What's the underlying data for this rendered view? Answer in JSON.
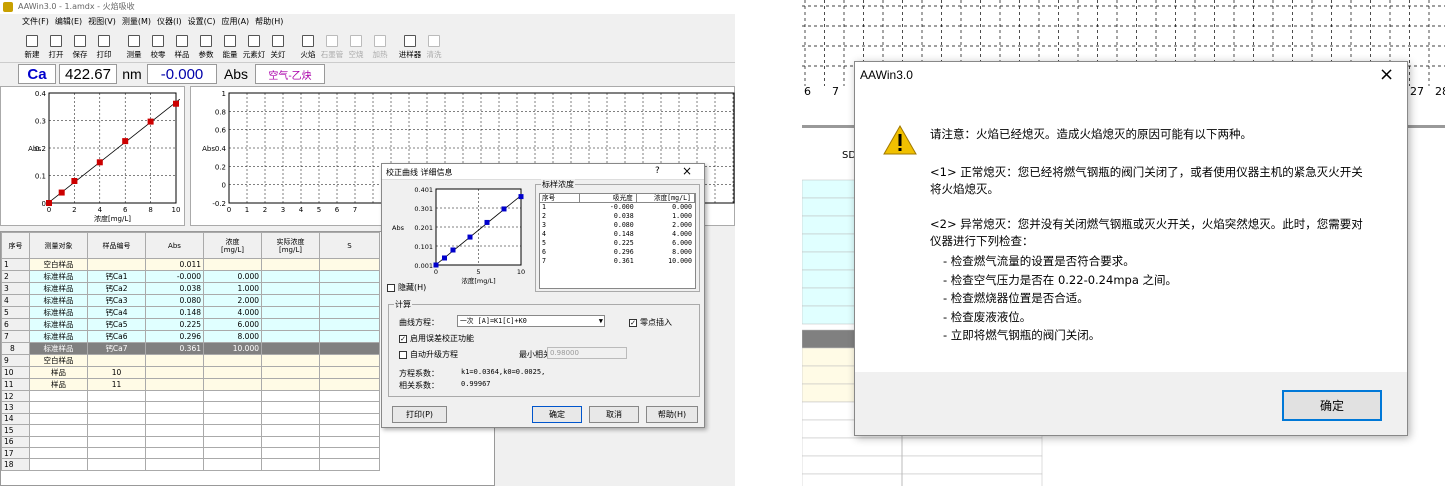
{
  "window": {
    "title": "AAWin3.0 - 1.amdx - 火焰吸收"
  },
  "menu": [
    "文件(F)",
    "编辑(E)",
    "视图(V)",
    "测量(M)",
    "仪器(I)",
    "设置(C)",
    "应用(A)",
    "帮助(H)"
  ],
  "toolbar": [
    {
      "label": "新建",
      "icon": "new-file-icon",
      "enabled": true
    },
    {
      "label": "打开",
      "icon": "open-folder-icon",
      "enabled": true
    },
    {
      "label": "保存",
      "icon": "save-icon",
      "enabled": true
    },
    {
      "label": "打印",
      "icon": "print-icon",
      "enabled": true
    },
    {
      "label": "测量",
      "icon": "play-icon",
      "enabled": true
    },
    {
      "label": "校零",
      "icon": "zero-icon",
      "enabled": true
    },
    {
      "label": "样品",
      "icon": "sample-icon",
      "enabled": true
    },
    {
      "label": "参数",
      "icon": "param-icon",
      "enabled": true
    },
    {
      "label": "能量",
      "icon": "energy-icon",
      "enabled": true
    },
    {
      "label": "元素灯",
      "icon": "lamp-icon",
      "enabled": true
    },
    {
      "label": "关灯",
      "icon": "lamp-off-icon",
      "enabled": true
    },
    {
      "label": "火焰",
      "icon": "flame-icon",
      "enabled": true
    },
    {
      "label": "石墨管",
      "icon": "graphite-icon",
      "enabled": false
    },
    {
      "label": "空烧",
      "icon": "burn-icon",
      "enabled": false
    },
    {
      "label": "加热",
      "icon": "heat-icon",
      "enabled": false
    },
    {
      "label": "进样器",
      "icon": "sampler-icon",
      "enabled": true
    },
    {
      "label": "清洗",
      "icon": "clean-icon",
      "enabled": false
    }
  ],
  "status": {
    "element": "Ca",
    "wavelength": "422.67",
    "wl_unit": "nm",
    "absorbance": "-0.000",
    "abs_unit": "Abs",
    "gas": "空气-乙炔"
  },
  "colors": {
    "point": "#cc0000",
    "dialog_point": "#0000cc",
    "selected_row": "#808080",
    "std_row": "#e0ffff",
    "sample_row": "#fffbe6",
    "warning": "#f0c000"
  },
  "main_chart": {
    "chart_data": {
      "type": "scatter",
      "x": [
        0,
        1,
        2,
        4,
        6,
        8,
        10
      ],
      "y": [
        -0.0,
        0.038,
        0.08,
        0.148,
        0.225,
        0.296,
        0.361
      ],
      "xlabel": "浓度[mg/L]",
      "ylabel": "Abs",
      "xlim": [
        0,
        10
      ],
      "ylim": [
        0,
        0.4
      ],
      "xticks": [
        "0",
        "2",
        "4",
        "6",
        "8",
        "10"
      ],
      "yticks": [
        "0",
        "0.1",
        "0.2",
        "0.3",
        "0.4"
      ],
      "grid": true
    }
  },
  "sample_chart": {
    "yticks": [
      "1",
      "0.8",
      "0.6",
      "0.4",
      "0.2",
      "0",
      "-0.2"
    ],
    "xticks": [
      "0",
      "1",
      "2",
      "3",
      "4",
      "5",
      "6",
      "7"
    ],
    "ylabel": "Abs"
  },
  "table": {
    "headers": [
      "序号",
      "测量对象",
      "样品编号",
      "Abs",
      "浓度\n[mg/L]",
      "实际浓度\n[mg/L]",
      "S"
    ],
    "rows": [
      [
        "1",
        "空白样品",
        "",
        "0.011",
        "",
        ""
      ],
      [
        "2",
        "标准样品",
        "钙Ca1",
        "-0.000",
        "0.000",
        ""
      ],
      [
        "3",
        "标准样品",
        "钙Ca2",
        "0.038",
        "1.000",
        ""
      ],
      [
        "4",
        "标准样品",
        "钙Ca3",
        "0.080",
        "2.000",
        ""
      ],
      [
        "5",
        "标准样品",
        "钙Ca4",
        "0.148",
        "4.000",
        ""
      ],
      [
        "6",
        "标准样品",
        "钙Ca5",
        "0.225",
        "6.000",
        ""
      ],
      [
        "7",
        "标准样品",
        "钙Ca6",
        "0.296",
        "8.000",
        ""
      ],
      [
        "8",
        "标准样品",
        "钙Ca7",
        "0.361",
        "10.000",
        ""
      ],
      [
        "9",
        "空白样品",
        "",
        "",
        "",
        ""
      ],
      [
        "10",
        "样品",
        "10",
        "",
        "",
        ""
      ],
      [
        "11",
        "样品",
        "11",
        "",
        "",
        ""
      ],
      [
        "12",
        "",
        "",
        "",
        "",
        ""
      ],
      [
        "13",
        "",
        "",
        "",
        "",
        ""
      ],
      [
        "14",
        "",
        "",
        "",
        "",
        ""
      ],
      [
        "15",
        "",
        "",
        "",
        "",
        ""
      ],
      [
        "16",
        "",
        "",
        "",
        "",
        ""
      ],
      [
        "17",
        "",
        "",
        "",
        "",
        ""
      ],
      [
        "18",
        "",
        "",
        "",
        "",
        ""
      ]
    ],
    "selected_row": 7
  },
  "calib_dialog": {
    "title": "校正曲线 详细信息",
    "help": "?",
    "close": "×",
    "chart_data": {
      "type": "scatter",
      "x": [
        0,
        1,
        2,
        4,
        6,
        8,
        10
      ],
      "y": [
        0.001,
        0.038,
        0.08,
        0.148,
        0.225,
        0.296,
        0.361
      ],
      "xlabel": "浓度[mg/L]",
      "ylabel": "Abs",
      "xlim": [
        0,
        10
      ],
      "ylim": [
        0,
        0.4
      ],
      "xticks": [
        "0",
        "5",
        "10"
      ],
      "yticks": [
        "0.001",
        "0.101",
        "0.201",
        "0.301",
        "0.401"
      ]
    },
    "hide_label": "隐藏(H)",
    "std_group": "标样浓度",
    "std_headers": [
      "序号",
      "吸光度",
      "浓度[mg/L]"
    ],
    "std_rows": [
      [
        "1",
        "-0.000",
        "0.000"
      ],
      [
        "2",
        "0.038",
        "1.000"
      ],
      [
        "3",
        "0.080",
        "2.000"
      ],
      [
        "4",
        "0.148",
        "4.000"
      ],
      [
        "5",
        "0.225",
        "6.000"
      ],
      [
        "6",
        "0.296",
        "8.000"
      ],
      [
        "7",
        "0.361",
        "10.000"
      ]
    ],
    "calc_group": "计算",
    "eq_label": "曲线方程：",
    "eq_value": "一次 [A]=K1[C]+K0",
    "zero_label": "零点插入",
    "err_label": "启用误差校正功能",
    "auto_label": "自动升级方程",
    "mincorr_label": "最小相关系数",
    "mincorr_value": "0.98000",
    "coef_label": "方程系数：",
    "coef_value": "k1=0.0364,k0=0.0025,",
    "corr_label": "相关系数：",
    "corr_value": "0.99967",
    "print_btn": "打印(P)",
    "ok_btn": "确定",
    "cancel_btn": "取消",
    "help_btn": "帮助(H)"
  },
  "bg_right": {
    "ruler_left": [
      "6",
      "7"
    ],
    "ruler_right": [
      "27",
      "28"
    ],
    "sd": "SD"
  },
  "alert": {
    "title": "AAWin3.0",
    "close": "×",
    "heading": "请注意：火焰已经熄灭。造成火焰熄灭的原因可能有以下两种。",
    "p1": "<1> 正常熄灭：您已经将燃气钢瓶的阀门关闭了，或者使用仪器主机的紧急灭火开关将火焰熄灭。",
    "p2": "<2> 异常熄灭：您并没有关闭燃气钢瓶或灭火开关，火焰突然熄灭。此时，您需要对仪器进行下列检查：",
    "items": [
      "- 检查燃气流量的设置是否符合要求。",
      "- 检查空气压力是否在 0.22-0.24mpa 之间。",
      "- 检查燃烧器位置是否合适。",
      "- 检查废液液位。",
      "- 立即将燃气钢瓶的阀门关闭。"
    ],
    "ok": "确定"
  }
}
